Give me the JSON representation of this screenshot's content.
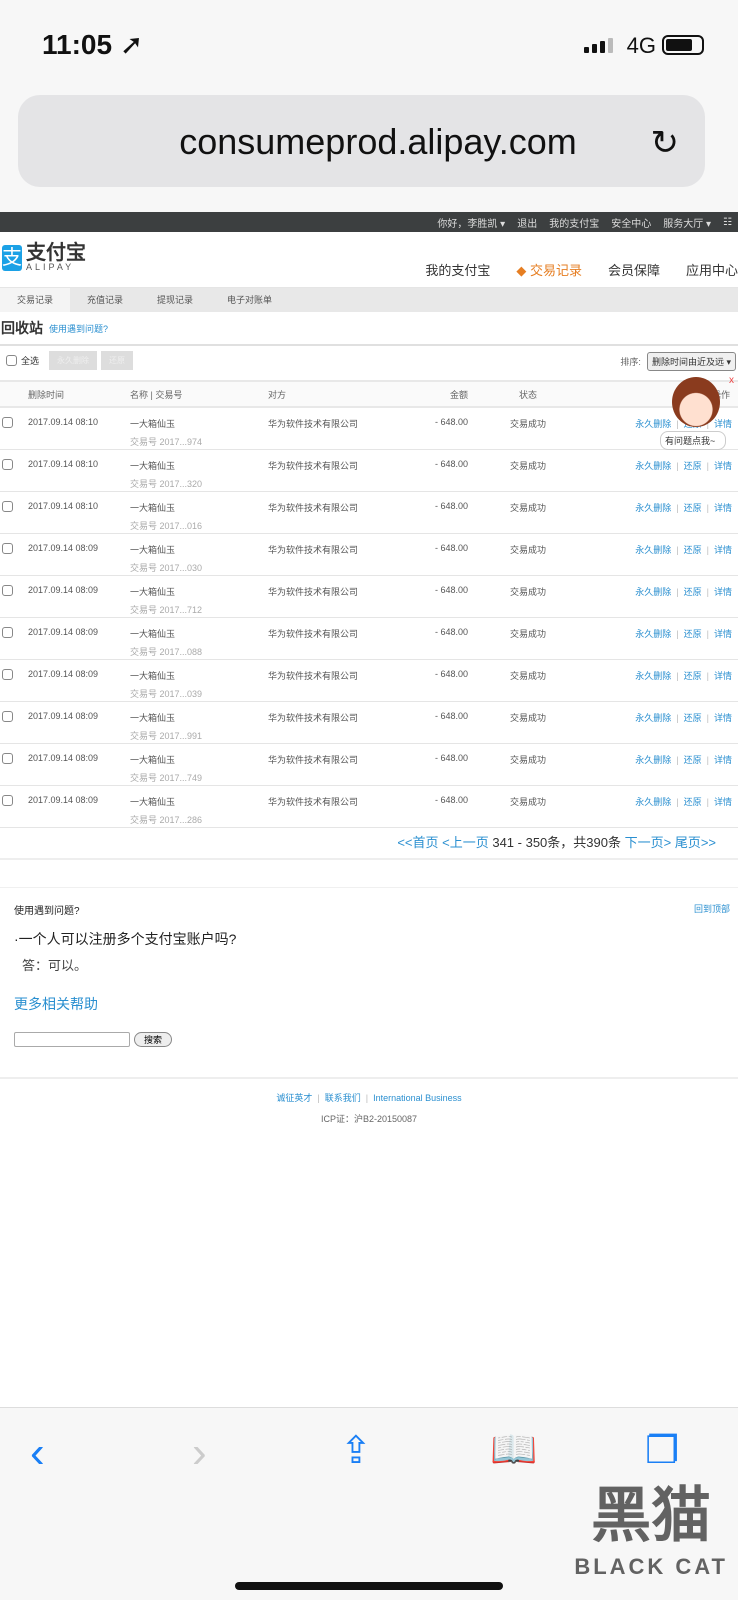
{
  "status": {
    "time": "11:05",
    "network": "4G"
  },
  "browser": {
    "url": "consumeprod.alipay.com"
  },
  "topbar": {
    "greeting": "你好，",
    "user": "李胜凯 ▾",
    "logout": "退出",
    "my": "我的支付宝",
    "security": "安全中心",
    "service": "服务大厅 ▾"
  },
  "logo": {
    "cn": "支付宝",
    "en": "ALIPAY",
    "mark": "支"
  },
  "nav": [
    "我的支付宝",
    "交易记录",
    "会员保障",
    "应用中心"
  ],
  "subnav": [
    "交易记录",
    "充值记录",
    "提现记录",
    "电子对账单"
  ],
  "title": {
    "text": "回收站",
    "help": "使用遇到问题?"
  },
  "toolbar": {
    "select_all": "全选",
    "delete": "永久删除",
    "restore": "还原",
    "sort_label": "排序:",
    "sort_value": "删除时间由近及远"
  },
  "table": {
    "headers": [
      "删除时间",
      "名称 | 交易号",
      "对方",
      "金额",
      "状态",
      "操作"
    ],
    "rows": [
      {
        "time": "2017.09.14 08:10",
        "name": "一大箱仙玉",
        "no": "交易号 2017...974",
        "party": "华为软件技术有限公司",
        "amount": "- 648.00",
        "status": "交易成功"
      },
      {
        "time": "2017.09.14 08:10",
        "name": "一大箱仙玉",
        "no": "交易号 2017...320",
        "party": "华为软件技术有限公司",
        "amount": "- 648.00",
        "status": "交易成功"
      },
      {
        "time": "2017.09.14 08:10",
        "name": "一大箱仙玉",
        "no": "交易号 2017...016",
        "party": "华为软件技术有限公司",
        "amount": "- 648.00",
        "status": "交易成功"
      },
      {
        "time": "2017.09.14 08:09",
        "name": "一大箱仙玉",
        "no": "交易号 2017...030",
        "party": "华为软件技术有限公司",
        "amount": "- 648.00",
        "status": "交易成功"
      },
      {
        "time": "2017.09.14 08:09",
        "name": "一大箱仙玉",
        "no": "交易号 2017...712",
        "party": "华为软件技术有限公司",
        "amount": "- 648.00",
        "status": "交易成功"
      },
      {
        "time": "2017.09.14 08:09",
        "name": "一大箱仙玉",
        "no": "交易号 2017...088",
        "party": "华为软件技术有限公司",
        "amount": "- 648.00",
        "status": "交易成功"
      },
      {
        "time": "2017.09.14 08:09",
        "name": "一大箱仙玉",
        "no": "交易号 2017...039",
        "party": "华为软件技术有限公司",
        "amount": "- 648.00",
        "status": "交易成功"
      },
      {
        "time": "2017.09.14 08:09",
        "name": "一大箱仙玉",
        "no": "交易号 2017...991",
        "party": "华为软件技术有限公司",
        "amount": "- 648.00",
        "status": "交易成功"
      },
      {
        "time": "2017.09.14 08:09",
        "name": "一大箱仙玉",
        "no": "交易号 2017...749",
        "party": "华为软件技术有限公司",
        "amount": "- 648.00",
        "status": "交易成功"
      },
      {
        "time": "2017.09.14 08:09",
        "name": "一大箱仙玉",
        "no": "交易号 2017...286",
        "party": "华为软件技术有限公司",
        "amount": "- 648.00",
        "status": "交易成功"
      }
    ],
    "actions": {
      "delete": "永久删除",
      "restore": "还原",
      "detail": "详情"
    }
  },
  "pager": {
    "first": "<<首页",
    "prev": "<上一页",
    "info": " 341 - 350条，共390条 ",
    "next": "下一页>",
    "last": "尾页>>"
  },
  "help": {
    "heading": "使用遇到问题?",
    "back_top": "回到顶部",
    "question": "·一个人可以注册多个支付宝账户吗?",
    "answer": "答：可以。",
    "more": "更多相关帮助",
    "search": "搜索"
  },
  "mascot": {
    "tip": "有问题点我~",
    "close": "x"
  },
  "footer": {
    "links": [
      "诚征英才",
      "联系我们",
      "International Business"
    ],
    "icp": "ICP证：沪B2-20150087"
  },
  "watermark": {
    "cn": "黑猫",
    "en": "BLACK CAT"
  }
}
